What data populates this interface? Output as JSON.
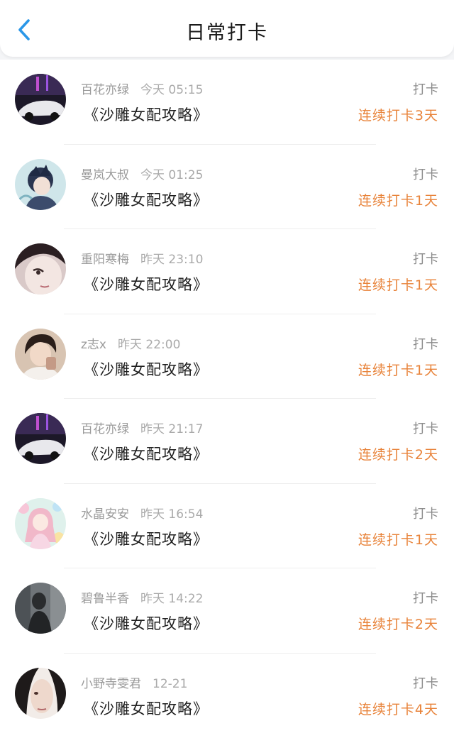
{
  "header": {
    "title": "日常打卡",
    "back_icon": "chevron-left-icon",
    "accent_color": "#2a97e8"
  },
  "checkins": [
    {
      "user": "百花亦绿",
      "time": "今天 05:15",
      "post": "《沙雕女配攻略》",
      "tag": "打卡",
      "streak": "连续打卡3天"
    },
    {
      "user": "曼岚大叔",
      "time": "今天 01:25",
      "post": "《沙雕女配攻略》",
      "tag": "打卡",
      "streak": "连续打卡1天"
    },
    {
      "user": "重阳寒梅",
      "time": "昨天 23:10",
      "post": "《沙雕女配攻略》",
      "tag": "打卡",
      "streak": "连续打卡1天"
    },
    {
      "user": "z志x",
      "time": "昨天 22:00",
      "post": "《沙雕女配攻略》",
      "tag": "打卡",
      "streak": "连续打卡1天"
    },
    {
      "user": "百花亦绿",
      "time": "昨天 21:17",
      "post": "《沙雕女配攻略》",
      "tag": "打卡",
      "streak": "连续打卡2天"
    },
    {
      "user": "水晶安安",
      "time": "昨天 16:54",
      "post": "《沙雕女配攻略》",
      "tag": "打卡",
      "streak": "连续打卡1天"
    },
    {
      "user": "碧鲁半香",
      "time": "昨天 14:22",
      "post": "《沙雕女配攻略》",
      "tag": "打卡",
      "streak": "连续打卡2天"
    },
    {
      "user": "小野寺雯君",
      "time": "12-21",
      "post": "《沙雕女配攻略》",
      "tag": "打卡",
      "streak": "连续打卡4天"
    }
  ],
  "colors": {
    "streak": "#e8833a",
    "muted_text": "#9a9a9a"
  }
}
